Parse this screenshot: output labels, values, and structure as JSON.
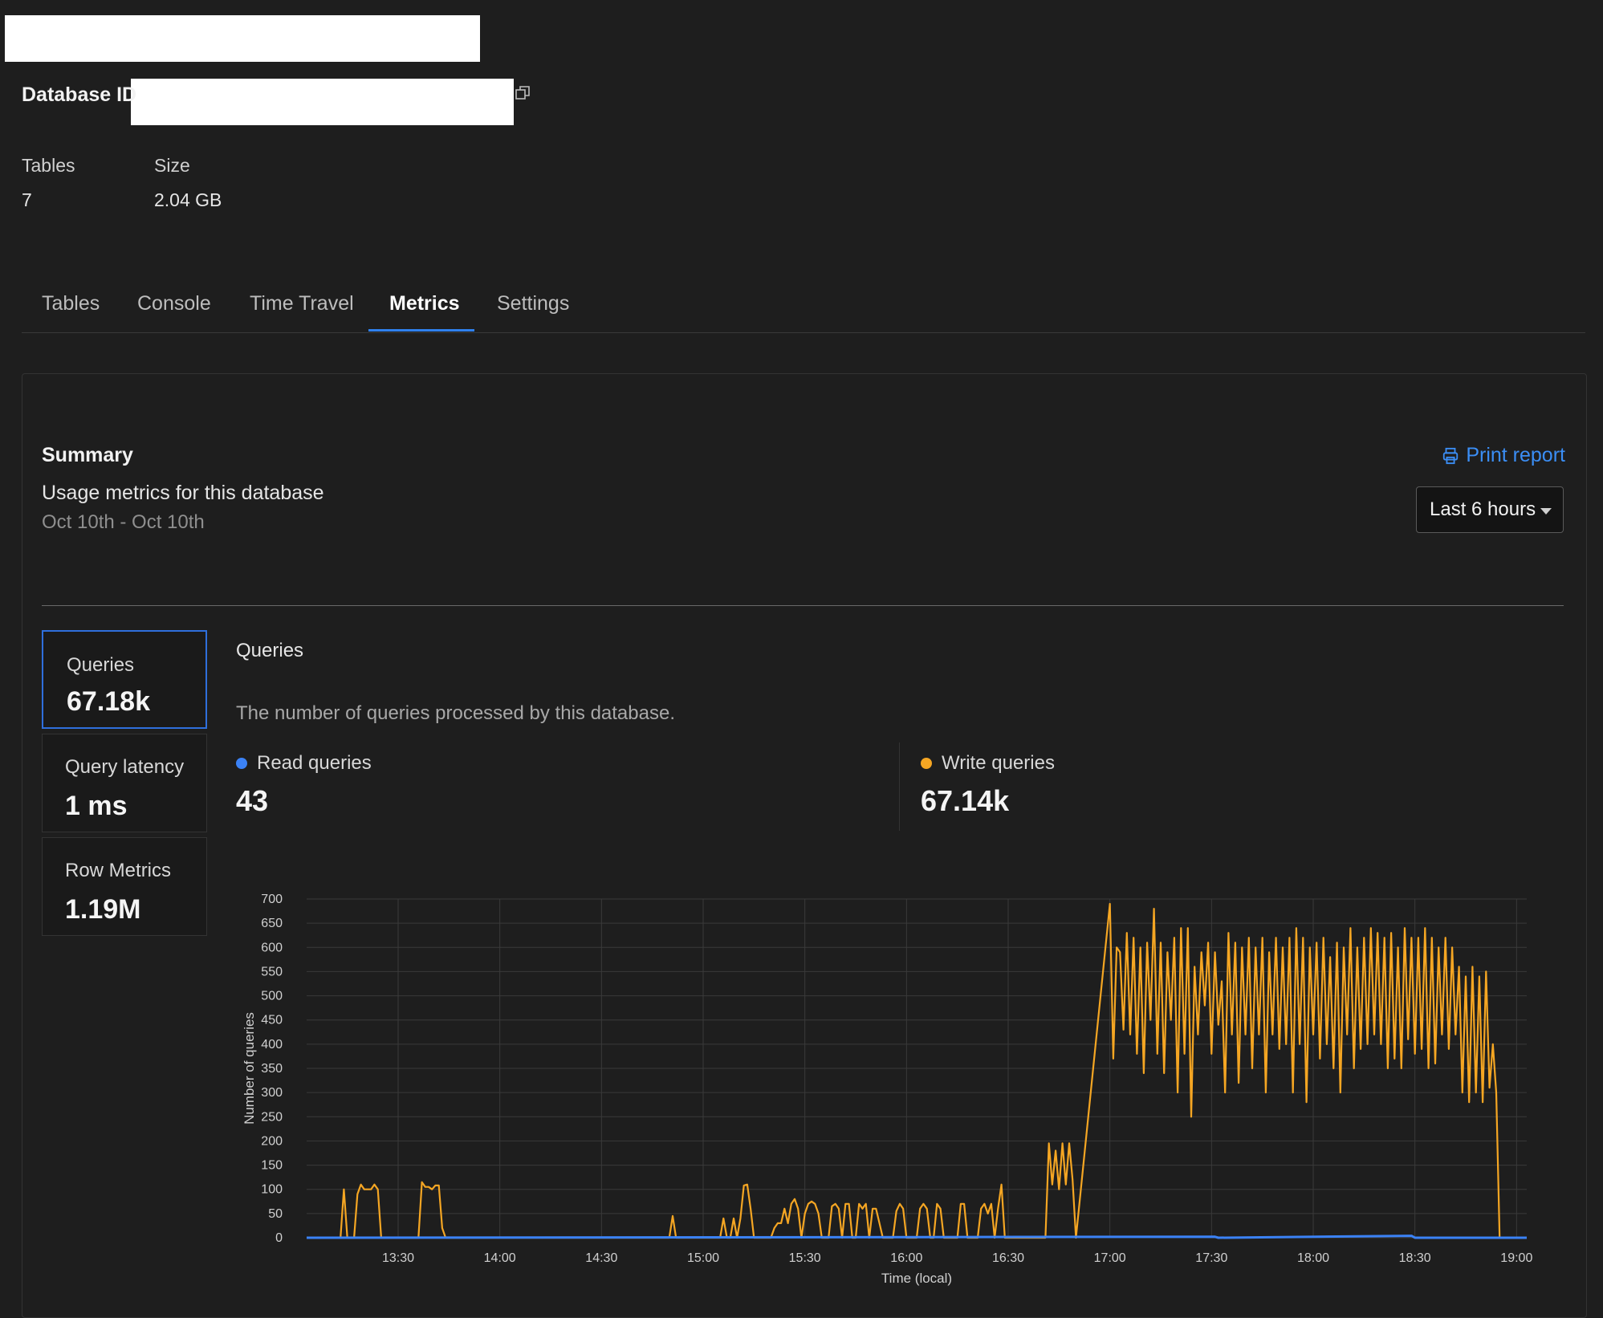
{
  "header": {
    "database_id_label": "Database ID",
    "stats": [
      {
        "label": "Tables",
        "value": "7"
      },
      {
        "label": "Size",
        "value": "2.04 GB"
      }
    ]
  },
  "tabs": [
    {
      "label": "Tables",
      "active": false
    },
    {
      "label": "Console",
      "active": false
    },
    {
      "label": "Time Travel",
      "active": false
    },
    {
      "label": "Metrics",
      "active": true
    },
    {
      "label": "Settings",
      "active": false
    }
  ],
  "summary": {
    "title": "Summary",
    "subtitle": "Usage metrics for this database",
    "date_range": "Oct 10th - Oct 10th",
    "print_label": "Print report",
    "range_selected": "Last 6 hours"
  },
  "metric_cards": [
    {
      "label": "Queries",
      "value": "67.18k",
      "active": true
    },
    {
      "label": "Query latency",
      "value": "1 ms",
      "active": false
    },
    {
      "label": "Row Metrics",
      "value": "1.19M",
      "active": false
    }
  ],
  "queries_panel": {
    "title": "Queries",
    "description": "The number of queries processed by this database.",
    "read": {
      "label": "Read queries",
      "value": "43",
      "color": "#3b82f6"
    },
    "write": {
      "label": "Write queries",
      "value": "67.14k",
      "color": "#f5a623"
    }
  },
  "colors": {
    "accent": "#2f80ed",
    "link": "#3b8ef5",
    "read": "#3b82f6",
    "write": "#f5a623"
  },
  "chart_data": {
    "type": "line",
    "title": "",
    "xlabel": "Time (local)",
    "ylabel": "Number of queries",
    "ylim": [
      0,
      700
    ],
    "yticks": [
      0,
      50,
      100,
      150,
      200,
      250,
      300,
      350,
      400,
      450,
      500,
      550,
      600,
      650,
      700
    ],
    "xlim": [
      "13:03",
      "19:03"
    ],
    "xticks": [
      "13:30",
      "14:00",
      "14:30",
      "15:00",
      "15:30",
      "16:00",
      "16:30",
      "17:00",
      "17:30",
      "18:00",
      "18:30",
      "19:00"
    ],
    "grid": true,
    "series": [
      {
        "name": "Write queries",
        "color": "#f5a623",
        "points": [
          [
            "13:03",
            0
          ],
          [
            "13:13",
            0
          ],
          [
            "13:14",
            100
          ],
          [
            "13:15",
            0
          ],
          [
            "13:17",
            0
          ],
          [
            "13:18",
            90
          ],
          [
            "13:19",
            110
          ],
          [
            "13:20",
            100
          ],
          [
            "13:21",
            100
          ],
          [
            "13:22",
            100
          ],
          [
            "13:23",
            110
          ],
          [
            "13:24",
            100
          ],
          [
            "13:25",
            0
          ],
          [
            "13:36",
            0
          ],
          [
            "13:37",
            115
          ],
          [
            "13:38",
            105
          ],
          [
            "13:39",
            105
          ],
          [
            "13:40",
            100
          ],
          [
            "13:41",
            108
          ],
          [
            "13:42",
            108
          ],
          [
            "13:43",
            20
          ],
          [
            "13:44",
            0
          ],
          [
            "14:50",
            0
          ],
          [
            "14:51",
            45
          ],
          [
            "14:52",
            0
          ],
          [
            "15:05",
            0
          ],
          [
            "15:06",
            40
          ],
          [
            "15:07",
            0
          ],
          [
            "15:08",
            0
          ],
          [
            "15:09",
            40
          ],
          [
            "15:10",
            0
          ],
          [
            "15:11",
            40
          ],
          [
            "15:12",
            108
          ],
          [
            "15:13",
            110
          ],
          [
            "15:14",
            60
          ],
          [
            "15:15",
            0
          ],
          [
            "15:20",
            0
          ],
          [
            "15:21",
            20
          ],
          [
            "15:22",
            30
          ],
          [
            "15:23",
            30
          ],
          [
            "15:24",
            60
          ],
          [
            "15:25",
            30
          ],
          [
            "15:26",
            70
          ],
          [
            "15:27",
            80
          ],
          [
            "15:28",
            60
          ],
          [
            "15:29",
            0
          ],
          [
            "15:30",
            50
          ],
          [
            "15:31",
            70
          ],
          [
            "15:32",
            75
          ],
          [
            "15:33",
            70
          ],
          [
            "15:34",
            50
          ],
          [
            "15:35",
            0
          ],
          [
            "15:37",
            0
          ],
          [
            "15:38",
            65
          ],
          [
            "15:39",
            70
          ],
          [
            "15:40",
            60
          ],
          [
            "15:41",
            0
          ],
          [
            "15:42",
            70
          ],
          [
            "15:43",
            70
          ],
          [
            "15:44",
            0
          ],
          [
            "15:45",
            0
          ],
          [
            "15:46",
            70
          ],
          [
            "15:47",
            60
          ],
          [
            "15:48",
            70
          ],
          [
            "15:49",
            0
          ],
          [
            "15:50",
            60
          ],
          [
            "15:51",
            60
          ],
          [
            "15:52",
            30
          ],
          [
            "15:53",
            0
          ],
          [
            "15:56",
            0
          ],
          [
            "15:57",
            55
          ],
          [
            "15:58",
            70
          ],
          [
            "15:59",
            60
          ],
          [
            "16:00",
            0
          ],
          [
            "16:03",
            0
          ],
          [
            "16:04",
            60
          ],
          [
            "16:05",
            70
          ],
          [
            "16:06",
            60
          ],
          [
            "16:07",
            0
          ],
          [
            "16:08",
            0
          ],
          [
            "16:09",
            70
          ],
          [
            "16:10",
            60
          ],
          [
            "16:11",
            0
          ],
          [
            "16:15",
            0
          ],
          [
            "16:16",
            70
          ],
          [
            "16:17",
            70
          ],
          [
            "16:18",
            0
          ],
          [
            "16:21",
            0
          ],
          [
            "16:22",
            60
          ],
          [
            "16:23",
            70
          ],
          [
            "16:24",
            50
          ],
          [
            "16:25",
            70
          ],
          [
            "16:26",
            0
          ],
          [
            "16:27",
            60
          ],
          [
            "16:28",
            110
          ],
          [
            "16:29",
            0
          ],
          [
            "16:41",
            0
          ],
          [
            "16:42",
            195
          ],
          [
            "16:43",
            110
          ],
          [
            "16:44",
            180
          ],
          [
            "16:45",
            100
          ],
          [
            "16:46",
            195
          ],
          [
            "16:47",
            110
          ],
          [
            "16:48",
            195
          ],
          [
            "16:49",
            120
          ],
          [
            "16:50",
            0
          ],
          [
            "17:00",
            690
          ],
          [
            "17:01",
            370
          ],
          [
            "17:02",
            600
          ],
          [
            "17:03",
            590
          ],
          [
            "17:04",
            430
          ],
          [
            "17:05",
            630
          ],
          [
            "17:06",
            420
          ],
          [
            "17:07",
            620
          ],
          [
            "17:08",
            380
          ],
          [
            "17:09",
            600
          ],
          [
            "17:10",
            340
          ],
          [
            "17:11",
            610
          ],
          [
            "17:12",
            450
          ],
          [
            "17:13",
            680
          ],
          [
            "17:14",
            380
          ],
          [
            "17:15",
            610
          ],
          [
            "17:16",
            340
          ],
          [
            "17:17",
            590
          ],
          [
            "17:18",
            450
          ],
          [
            "17:19",
            620
          ],
          [
            "17:20",
            300
          ],
          [
            "17:21",
            640
          ],
          [
            "17:22",
            380
          ],
          [
            "17:23",
            640
          ],
          [
            "17:24",
            250
          ],
          [
            "17:25",
            560
          ],
          [
            "17:26",
            420
          ],
          [
            "17:27",
            590
          ],
          [
            "17:28",
            480
          ],
          [
            "17:29",
            610
          ],
          [
            "17:30",
            380
          ],
          [
            "17:31",
            590
          ],
          [
            "17:32",
            440
          ],
          [
            "17:33",
            530
          ],
          [
            "17:34",
            300
          ],
          [
            "17:35",
            630
          ],
          [
            "17:36",
            420
          ],
          [
            "17:37",
            610
          ],
          [
            "17:38",
            320
          ],
          [
            "17:39",
            600
          ],
          [
            "17:40",
            420
          ],
          [
            "17:41",
            620
          ],
          [
            "17:42",
            350
          ],
          [
            "17:43",
            600
          ],
          [
            "17:44",
            420
          ],
          [
            "17:45",
            620
          ],
          [
            "17:46",
            300
          ],
          [
            "17:47",
            590
          ],
          [
            "17:48",
            420
          ],
          [
            "17:49",
            620
          ],
          [
            "17:50",
            390
          ],
          [
            "17:51",
            600
          ],
          [
            "17:52",
            400
          ],
          [
            "17:53",
            620
          ],
          [
            "17:54",
            300
          ],
          [
            "17:55",
            640
          ],
          [
            "17:56",
            400
          ],
          [
            "17:57",
            620
          ],
          [
            "17:58",
            280
          ],
          [
            "17:59",
            600
          ],
          [
            "18:00",
            420
          ],
          [
            "18:01",
            610
          ],
          [
            "18:02",
            370
          ],
          [
            "18:03",
            620
          ],
          [
            "18:04",
            400
          ],
          [
            "18:05",
            580
          ],
          [
            "18:06",
            350
          ],
          [
            "18:07",
            610
          ],
          [
            "18:08",
            300
          ],
          [
            "18:09",
            600
          ],
          [
            "18:10",
            420
          ],
          [
            "18:11",
            640
          ],
          [
            "18:12",
            350
          ],
          [
            "18:13",
            600
          ],
          [
            "18:14",
            390
          ],
          [
            "18:15",
            620
          ],
          [
            "18:16",
            400
          ],
          [
            "18:17",
            640
          ],
          [
            "18:18",
            420
          ],
          [
            "18:19",
            630
          ],
          [
            "18:20",
            400
          ],
          [
            "18:21",
            620
          ],
          [
            "18:22",
            350
          ],
          [
            "18:23",
            630
          ],
          [
            "18:24",
            370
          ],
          [
            "18:25",
            600
          ],
          [
            "18:26",
            350
          ],
          [
            "18:27",
            640
          ],
          [
            "18:28",
            410
          ],
          [
            "18:29",
            620
          ],
          [
            "18:30",
            380
          ],
          [
            "18:31",
            620
          ],
          [
            "18:32",
            390
          ],
          [
            "18:33",
            640
          ],
          [
            "18:34",
            350
          ],
          [
            "18:35",
            620
          ],
          [
            "18:36",
            360
          ],
          [
            "18:37",
            600
          ],
          [
            "18:38",
            420
          ],
          [
            "18:39",
            620
          ],
          [
            "18:40",
            390
          ],
          [
            "18:41",
            600
          ],
          [
            "18:42",
            420
          ],
          [
            "18:43",
            560
          ],
          [
            "18:44",
            300
          ],
          [
            "18:45",
            540
          ],
          [
            "18:46",
            280
          ],
          [
            "18:47",
            560
          ],
          [
            "18:48",
            300
          ],
          [
            "18:49",
            540
          ],
          [
            "18:50",
            280
          ],
          [
            "18:51",
            550
          ],
          [
            "18:52",
            310
          ],
          [
            "18:53",
            400
          ],
          [
            "18:54",
            300
          ],
          [
            "18:55",
            0
          ],
          [
            "19:03",
            0
          ]
        ]
      },
      {
        "name": "Read queries",
        "color": "#3b82f6",
        "points": [
          [
            "13:03",
            0
          ],
          [
            "17:31",
            2
          ],
          [
            "17:32",
            0
          ],
          [
            "18:29",
            4
          ],
          [
            "18:30",
            0
          ],
          [
            "19:03",
            0
          ]
        ]
      }
    ]
  }
}
